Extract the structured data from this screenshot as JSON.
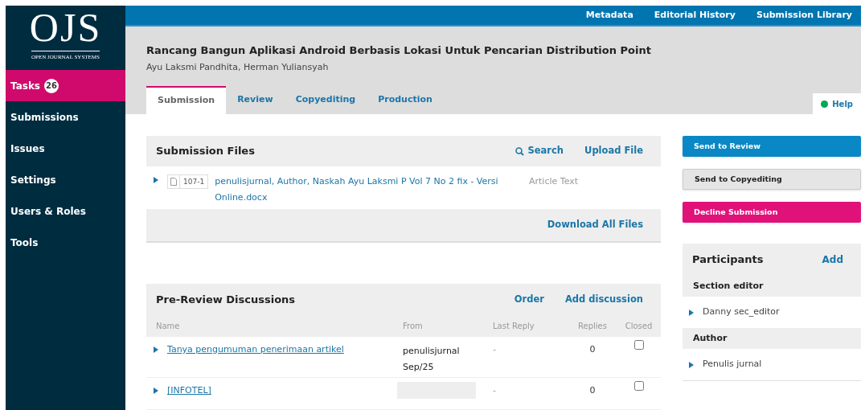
{
  "logo": {
    "mark": "OJS",
    "tagline": "OPEN JOURNAL SYSTEMS"
  },
  "sidebar": {
    "items": [
      {
        "label": "Tasks",
        "badge": "26",
        "selected": true
      },
      {
        "label": "Submissions",
        "selected": false
      },
      {
        "label": "Issues",
        "selected": false
      },
      {
        "label": "Settings",
        "selected": false
      },
      {
        "label": "Users & Roles",
        "selected": false
      },
      {
        "label": "Tools",
        "selected": false
      }
    ]
  },
  "top_bar": {
    "links": [
      "Metadata",
      "Editorial History",
      "Submission Library"
    ]
  },
  "submission": {
    "title": "Rancang Bangun Aplikasi Android Berbasis Lokasi Untuk Pencarian Distribution Point",
    "authors": "Ayu Laksmi Pandhita, Herman Yuliansyah"
  },
  "tabs": [
    {
      "label": "Submission",
      "selected": true
    },
    {
      "label": "Review",
      "selected": false
    },
    {
      "label": "Copyediting",
      "selected": false
    },
    {
      "label": "Production",
      "selected": false
    }
  ],
  "help": "Help",
  "submission_files": {
    "title": "Submission Files",
    "actions": [
      {
        "label": "Search",
        "kind": "search"
      },
      {
        "label": "Upload File",
        "kind": "plain"
      }
    ],
    "files": [
      {
        "id": "107-1",
        "name": "penulisjurnal, Author, Naskah Ayu Laksmi P Vol 7 No 2 fix - Versi Online.docx",
        "type": "Article Text"
      }
    ],
    "footer_action": "Download All Files"
  },
  "discussions": {
    "title": "Pre-Review Discussions",
    "actions": [
      "Order",
      "Add discussion"
    ],
    "columns": [
      "Name",
      "From",
      "Last Reply",
      "Replies",
      "Closed"
    ],
    "rows": [
      {
        "name": "Tanya pengumuman penerimaan artikel",
        "from": "penulisjurnal",
        "date": "Sep/25",
        "last_reply": "-",
        "replies": "0",
        "closed": false
      },
      {
        "name": "[INFOTEL]",
        "from_redacted": true,
        "last_reply": "-",
        "replies": "0",
        "closed": false
      }
    ]
  },
  "decision_buttons": [
    {
      "label": "Send to Review",
      "kind": "primary"
    },
    {
      "label": "Send to Copyediting",
      "kind": "default"
    },
    {
      "label": "Decline Submission",
      "kind": "danger"
    }
  ],
  "participants": {
    "title": "Participants",
    "action": "Add",
    "groups": [
      {
        "role": "Section editor",
        "people": [
          "Danny sec_editor"
        ]
      },
      {
        "role": "Author",
        "people": [
          "Penulis jurnal"
        ]
      }
    ]
  }
}
